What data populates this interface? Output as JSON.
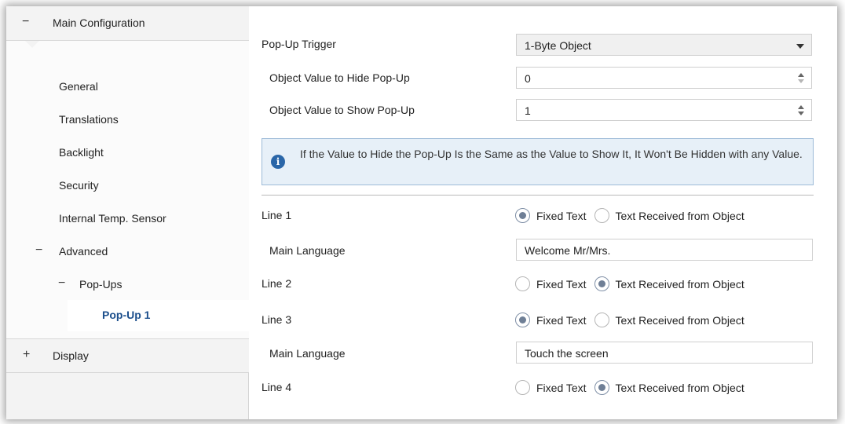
{
  "sidebar": {
    "main_configuration": {
      "sign": "−",
      "label": "Main Configuration"
    },
    "items": [
      {
        "label": "General"
      },
      {
        "label": "Translations"
      },
      {
        "label": "Backlight"
      },
      {
        "label": "Security"
      },
      {
        "label": "Internal Temp. Sensor"
      }
    ],
    "advanced": {
      "sign": "−",
      "label": "Advanced"
    },
    "popups": {
      "sign": "−",
      "label": "Pop-Ups"
    },
    "selected_item": {
      "label": "Pop-Up 1"
    },
    "display": {
      "sign": "+",
      "label": "Display"
    }
  },
  "main": {
    "trigger": {
      "label": "Pop-Up Trigger",
      "value": "1-Byte Object"
    },
    "hide_value": {
      "label": "Object Value to Hide Pop-Up",
      "value": "0"
    },
    "show_value": {
      "label": "Object Value to Show Pop-Up",
      "value": "1"
    },
    "info": {
      "icon": "info-icon",
      "text": "If the Value to Hide the Pop-Up Is the Same as the Value to Show It, It Won't Be Hidden with any Value."
    },
    "radio_options": {
      "fixed": "Fixed Text",
      "object": "Text Received from Object"
    },
    "lines": [
      {
        "label": "Line 1",
        "selected": "fixed",
        "main_language_label": "Main Language",
        "main_language_value": "Welcome Mr/Mrs."
      },
      {
        "label": "Line 2",
        "selected": "object"
      },
      {
        "label": "Line 3",
        "selected": "fixed",
        "main_language_label": "Main Language",
        "main_language_value": "Touch the screen"
      },
      {
        "label": "Line 4",
        "selected": "object"
      }
    ]
  },
  "colors": {
    "accent": "#1c4f8c",
    "info_bg": "#e7f0f8",
    "info_border": "#9dbbd8"
  }
}
